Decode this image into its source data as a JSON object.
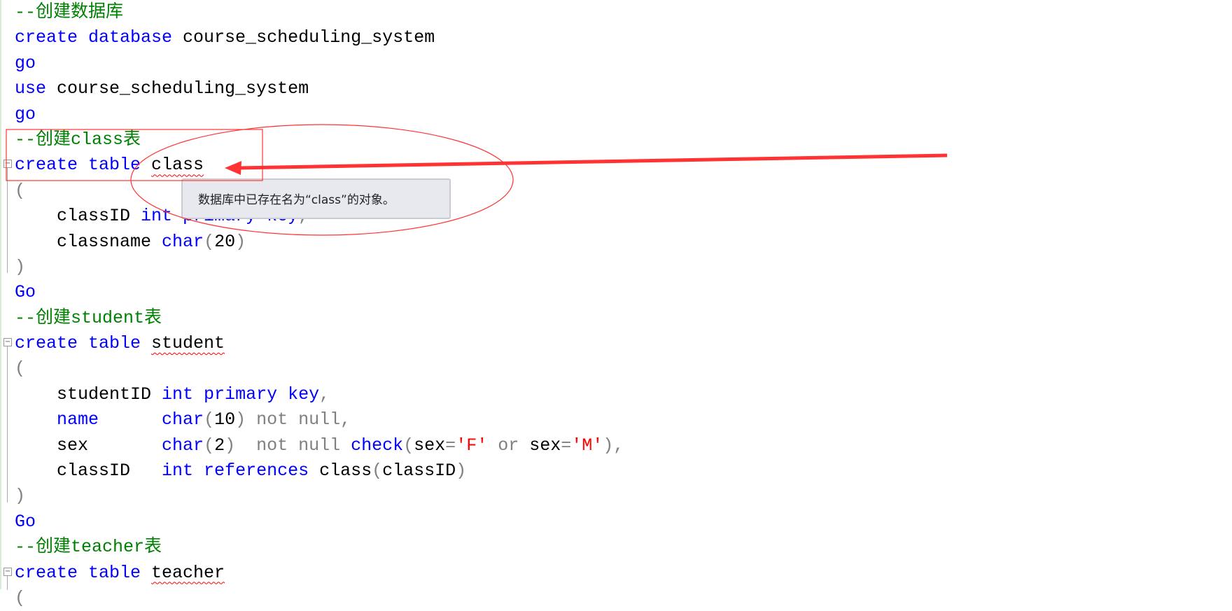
{
  "editor": {
    "lines": [
      [
        {
          "t": "--创建数据库",
          "c": "cm"
        }
      ],
      [
        {
          "t": "create database ",
          "c": "kw"
        },
        {
          "t": "course_scheduling_system",
          "c": "bk"
        }
      ],
      [
        {
          "t": "go",
          "c": "kw"
        }
      ],
      [
        {
          "t": "use ",
          "c": "kw"
        },
        {
          "t": "course_scheduling_system",
          "c": "bk"
        }
      ],
      [
        {
          "t": "go",
          "c": "kw"
        }
      ],
      [
        {
          "t": "--创建class表",
          "c": "cm"
        }
      ],
      [
        {
          "t": "create table ",
          "c": "kw"
        },
        {
          "t": "class",
          "c": "bk",
          "err": true
        }
      ],
      [
        {
          "t": "(",
          "c": "gr"
        }
      ],
      [
        {
          "t": "    classID ",
          "c": "bk"
        },
        {
          "t": "int primary key",
          "c": "kw"
        },
        {
          "t": ",",
          "c": "gr"
        }
      ],
      [
        {
          "t": "    classname ",
          "c": "bk"
        },
        {
          "t": "char",
          "c": "kw"
        },
        {
          "t": "(",
          "c": "gr"
        },
        {
          "t": "20",
          "c": "bk"
        },
        {
          "t": ")",
          "c": "gr"
        }
      ],
      [
        {
          "t": ")",
          "c": "gr"
        }
      ],
      [
        {
          "t": "Go",
          "c": "kw"
        }
      ],
      [
        {
          "t": "--创建student表",
          "c": "cm"
        }
      ],
      [
        {
          "t": "create table ",
          "c": "kw"
        },
        {
          "t": "student",
          "c": "bk",
          "err": true
        }
      ],
      [
        {
          "t": "(",
          "c": "gr"
        }
      ],
      [
        {
          "t": "    studentID ",
          "c": "bk"
        },
        {
          "t": "int primary key",
          "c": "kw"
        },
        {
          "t": ",",
          "c": "gr"
        }
      ],
      [
        {
          "t": "    name      ",
          "c": "kw"
        },
        {
          "t": "char",
          "c": "kw"
        },
        {
          "t": "(",
          "c": "gr"
        },
        {
          "t": "10",
          "c": "bk"
        },
        {
          "t": ") not null,",
          "c": "gr"
        }
      ],
      [
        {
          "t": "    sex       ",
          "c": "bk"
        },
        {
          "t": "char",
          "c": "kw"
        },
        {
          "t": "(",
          "c": "gr"
        },
        {
          "t": "2",
          "c": "bk"
        },
        {
          "t": ")  not null ",
          "c": "gr"
        },
        {
          "t": "check",
          "c": "kw"
        },
        {
          "t": "(",
          "c": "gr"
        },
        {
          "t": "sex",
          "c": "bk"
        },
        {
          "t": "=",
          "c": "gr"
        },
        {
          "t": "'F'",
          "c": "st"
        },
        {
          "t": " or ",
          "c": "gr"
        },
        {
          "t": "sex",
          "c": "bk"
        },
        {
          "t": "=",
          "c": "gr"
        },
        {
          "t": "'M'",
          "c": "st"
        },
        {
          "t": "),",
          "c": "gr"
        }
      ],
      [
        {
          "t": "    classID   ",
          "c": "bk"
        },
        {
          "t": "int references ",
          "c": "kw"
        },
        {
          "t": "class",
          "c": "bk"
        },
        {
          "t": "(",
          "c": "gr"
        },
        {
          "t": "classID",
          "c": "bk"
        },
        {
          "t": ")",
          "c": "gr"
        }
      ],
      [
        {
          "t": ")",
          "c": "gr"
        }
      ],
      [
        {
          "t": "Go",
          "c": "kw"
        }
      ],
      [
        {
          "t": "--创建teacher表",
          "c": "cm"
        }
      ],
      [
        {
          "t": "create table ",
          "c": "kw"
        },
        {
          "t": "teacher",
          "c": "bk",
          "err": true
        }
      ],
      [
        {
          "t": "(",
          "c": "gr"
        }
      ]
    ]
  },
  "tooltip": {
    "text": "数据库中已存在名为“class”的对象。"
  },
  "annotation": {
    "color": "#ff3333"
  }
}
